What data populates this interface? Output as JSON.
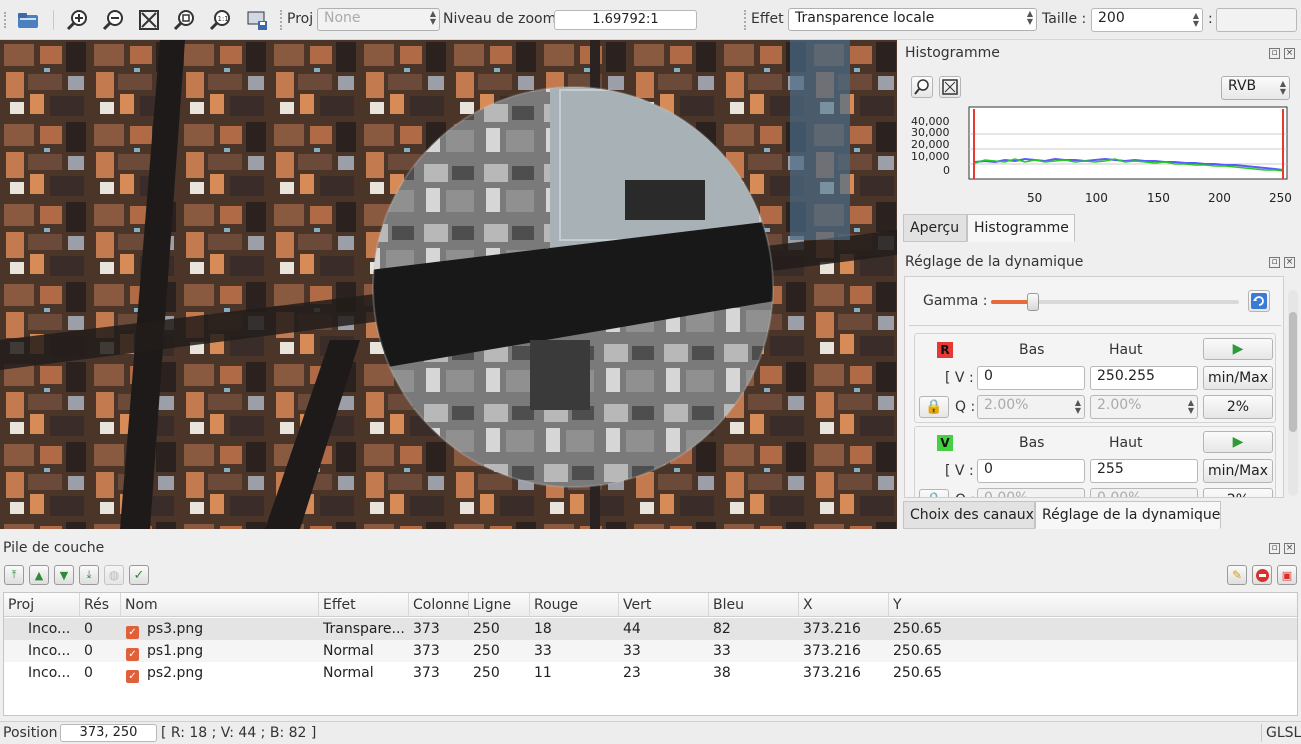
{
  "toolbar": {
    "proj_label": "Proj",
    "proj_value": "None",
    "zoom_label": "Niveau de zoom",
    "zoom_value": "1.69792:1",
    "effect_label": "Effet",
    "effect_value": "Transparence locale",
    "size_label": "Taille :",
    "size_value": "200",
    "extra_label": ":"
  },
  "histogram_dock": {
    "title": "Histogramme",
    "mode": "RVB",
    "y_ticks": [
      "40,000",
      "30,000",
      "20,000",
      "10,000",
      "0"
    ],
    "x_ticks": [
      "50",
      "100",
      "150",
      "200",
      "250"
    ],
    "tabs": [
      "Aperçu",
      "Histogramme"
    ],
    "active_tab": "Histogramme"
  },
  "dynamics_dock": {
    "title": "Réglage de la dynamique",
    "gamma_label": "Gamma :",
    "gamma_level": 0.17,
    "channels": [
      {
        "letter": "R",
        "color": "#e53935",
        "low_header": "Bas",
        "high_header": "Haut",
        "v_label": "[ V :",
        "v_low": "0",
        "v_high": "250.255",
        "minmax_label": "min/Max",
        "q_label": "Q :",
        "q_low": "2.00%",
        "q_high": "2.00%",
        "pct_label": "2%"
      },
      {
        "letter": "V",
        "color": "#43d142",
        "low_header": "Bas",
        "high_header": "Haut",
        "v_label": "[ V :",
        "v_low": "0",
        "v_high": "255",
        "minmax_label": "min/Max",
        "q_label": "Q :",
        "q_low": "0.00%",
        "q_high": "0.00%",
        "pct_label": "2%"
      }
    ],
    "tabs": [
      "Choix des canaux",
      "Réglage de la dynamique"
    ],
    "active_tab": "Réglage de la dynamique"
  },
  "layer_stack": {
    "title": "Pile de couche",
    "columns": [
      "Proj",
      "Rés",
      "Nom",
      "Effet",
      "Colonne",
      "Ligne",
      "Rouge",
      "Vert",
      "Bleu",
      "X",
      "Y"
    ],
    "rows": [
      {
        "proj": "Inco...",
        "res": "0",
        "name": "ps3.png",
        "effect": "Transpare...",
        "col": "373",
        "line": "250",
        "red": "18",
        "green": "44",
        "blue": "82",
        "x": "373.216",
        "y": "250.65"
      },
      {
        "proj": "Inco...",
        "res": "0",
        "name": "ps1.png",
        "effect": "Normal",
        "col": "373",
        "line": "250",
        "red": "33",
        "green": "33",
        "blue": "33",
        "x": "373.216",
        "y": "250.65"
      },
      {
        "proj": "Inco...",
        "res": "0",
        "name": "ps2.png",
        "effect": "Normal",
        "col": "373",
        "line": "250",
        "red": "11",
        "green": "23",
        "blue": "38",
        "x": "373.216",
        "y": "250.65"
      }
    ]
  },
  "status": {
    "position_label": "Position",
    "position_value": "373, 250",
    "pixel_info": "[ R: 18 ; V: 44 ; B: 82 ]",
    "renderer": "GLSL"
  }
}
